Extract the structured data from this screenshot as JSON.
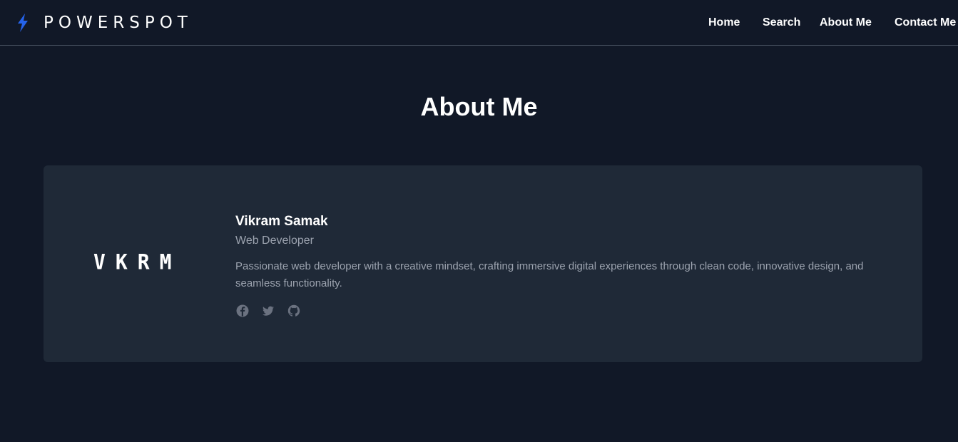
{
  "header": {
    "brand_name": "POWERSPOT",
    "brand_icon": "lightning-bolt-icon",
    "nav": {
      "home": "Home",
      "search": "Search",
      "about": "About Me",
      "contact": "Contact Me"
    }
  },
  "main": {
    "title": "About Me",
    "profile": {
      "logo_text": "VKRM",
      "name": "Vikram Samak",
      "role": "Web Developer",
      "bio": "Passionate web developer with a creative mindset, crafting immersive digital experiences through clean code, innovative design, and seamless functionality.",
      "socials": [
        "facebook-icon",
        "twitter-icon",
        "github-icon"
      ]
    }
  },
  "colors": {
    "background": "#111827",
    "card": "#1f2937",
    "accent": "#2563eb",
    "muted_text": "#9ca3af",
    "text": "#ffffff"
  }
}
